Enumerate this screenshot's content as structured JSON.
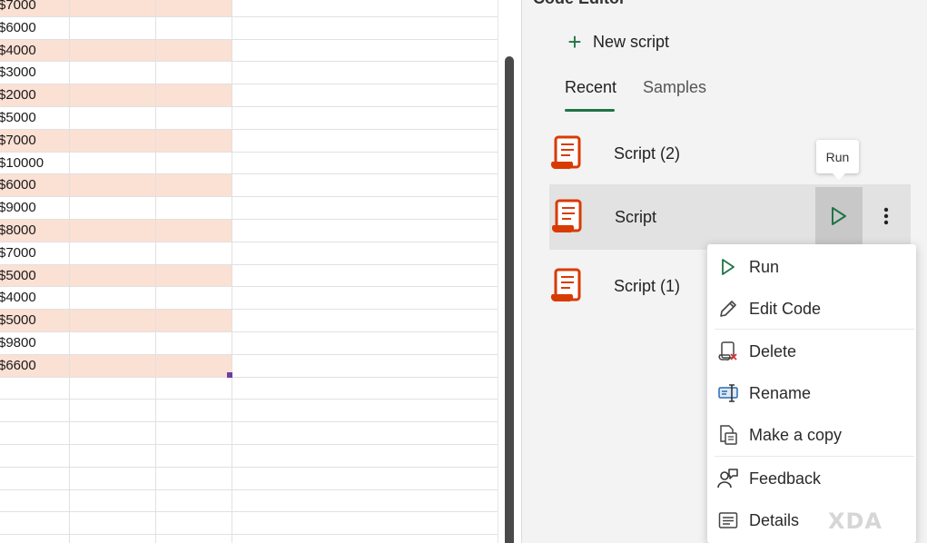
{
  "sheet": {
    "values": [
      "$7000",
      "$6000",
      "$4000",
      "$3000",
      "$2000",
      "$5000",
      "$7000",
      "$10000",
      "$6000",
      "$9000",
      "$8000",
      "$7000",
      "$5000",
      "$4000",
      "$5000",
      "$9800",
      "$6600"
    ],
    "shaded_color": "#fbe0d4"
  },
  "code_editor": {
    "title": "Code Editor",
    "new_script_label": "New script",
    "tabs": {
      "recent": "Recent",
      "samples": "Samples"
    },
    "scripts": [
      {
        "name": "Script (2)"
      },
      {
        "name": "Script"
      },
      {
        "name": "Script (1)"
      }
    ],
    "tooltip": "Run",
    "accent_color": "#217346",
    "script_icon_color": "#d83b01"
  },
  "context_menu": {
    "items": [
      {
        "label": "Run",
        "icon": "play-icon"
      },
      {
        "label": "Edit Code",
        "icon": "pencil-icon"
      },
      {
        "label": "Delete",
        "icon": "delete-script-icon"
      },
      {
        "label": "Rename",
        "icon": "rename-icon"
      },
      {
        "label": "Make a copy",
        "icon": "copy-icon"
      },
      {
        "label": "Feedback",
        "icon": "feedback-icon"
      },
      {
        "label": "Details",
        "icon": "details-icon"
      }
    ]
  },
  "watermark": "XDA"
}
